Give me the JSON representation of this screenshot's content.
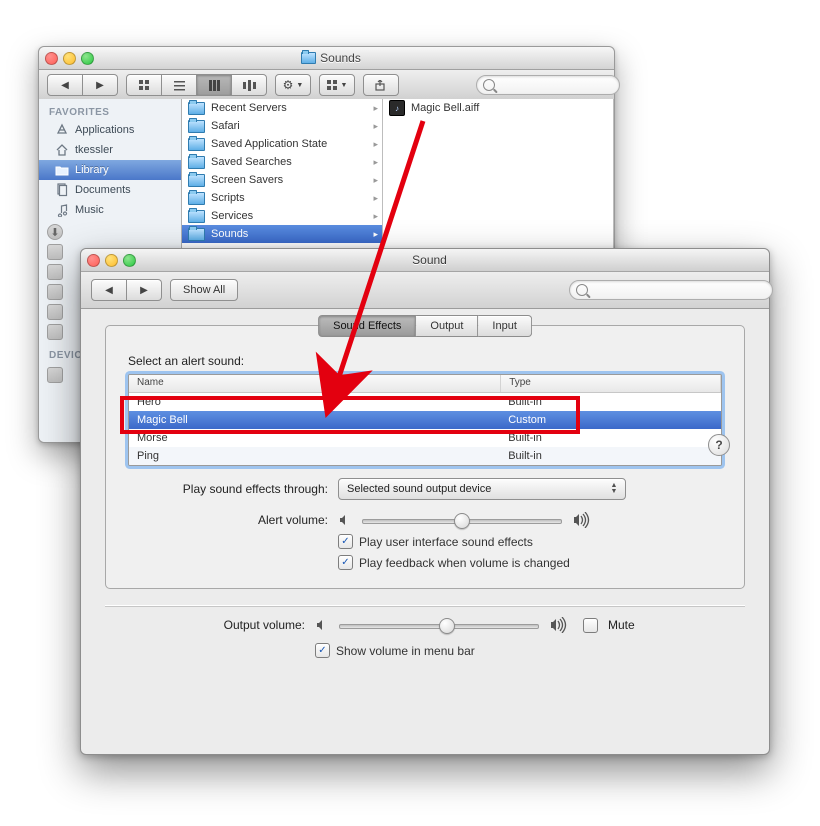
{
  "finder": {
    "title": "Sounds",
    "sidebar": {
      "favorites_label": "FAVORITES",
      "devices_label": "DEVICE",
      "items": [
        {
          "label": "Applications",
          "selected": false
        },
        {
          "label": "tkessler",
          "selected": false
        },
        {
          "label": "Library",
          "selected": true
        },
        {
          "label": "Documents",
          "selected": false
        },
        {
          "label": "Music",
          "selected": false
        }
      ]
    },
    "column1": [
      {
        "label": "Recent Servers"
      },
      {
        "label": "Safari"
      },
      {
        "label": "Saved Application State"
      },
      {
        "label": "Saved Searches"
      },
      {
        "label": "Screen Savers"
      },
      {
        "label": "Scripts"
      },
      {
        "label": "Services"
      },
      {
        "label": "Sounds",
        "selected": true
      }
    ],
    "column2": [
      {
        "label": "Magic Bell.aiff"
      }
    ]
  },
  "prefs": {
    "title": "Sound",
    "show_all": "Show All",
    "tabs": {
      "effects": "Sound Effects",
      "output": "Output",
      "input": "Input"
    },
    "select_label": "Select an alert sound:",
    "table": {
      "headers": {
        "name": "Name",
        "type": "Type"
      },
      "rows": [
        {
          "name": "Hero",
          "type": "Built-in"
        },
        {
          "name": "Magic Bell",
          "type": "Custom",
          "selected": true
        },
        {
          "name": "Morse",
          "type": "Built-in"
        },
        {
          "name": "Ping",
          "type": "Built-in"
        }
      ]
    },
    "play_through_label": "Play sound effects through:",
    "play_through_value": "Selected sound output device",
    "alert_volume_label": "Alert volume:",
    "chk_ui_sounds": "Play user interface sound effects",
    "chk_feedback": "Play feedback when volume is changed",
    "output_volume_label": "Output volume:",
    "mute_label": "Mute",
    "show_menu_label": "Show volume in menu bar"
  },
  "icons": {
    "triangle_left": "◀",
    "triangle_right": "▶",
    "gear": "⚙",
    "share": "↗",
    "check": "✓"
  }
}
